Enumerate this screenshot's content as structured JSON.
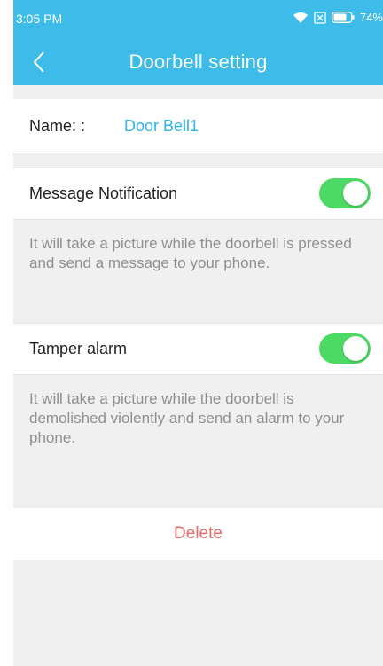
{
  "status_bar": {
    "time": "3:05 PM",
    "battery_percent": "74%",
    "wifi_icon": "wifi-icon",
    "sim_icon": "no-sim-icon",
    "battery_icon": "battery-icon"
  },
  "header": {
    "title": "Doorbell setting",
    "back_icon": "chevron-left-icon",
    "bg_color": "#3dbcea"
  },
  "device": {
    "name_label": "Name: :",
    "name_value": "Door Bell1"
  },
  "settings": [
    {
      "label": "Message Notification",
      "enabled": true,
      "description": "It will take a picture while the doorbell is pressed and send a message to your phone."
    },
    {
      "label": "Tamper alarm",
      "enabled": true,
      "description": "It will take a picture while the doorbell is demolished violently and send an alarm to your phone."
    }
  ],
  "actions": {
    "delete_label": "Delete",
    "delete_color": "#e96a6a"
  },
  "colors": {
    "accent": "#3dbcea",
    "toggle_on": "#4cd964",
    "link_blue": "#2fb4e4",
    "background": "#f0f0f0"
  }
}
